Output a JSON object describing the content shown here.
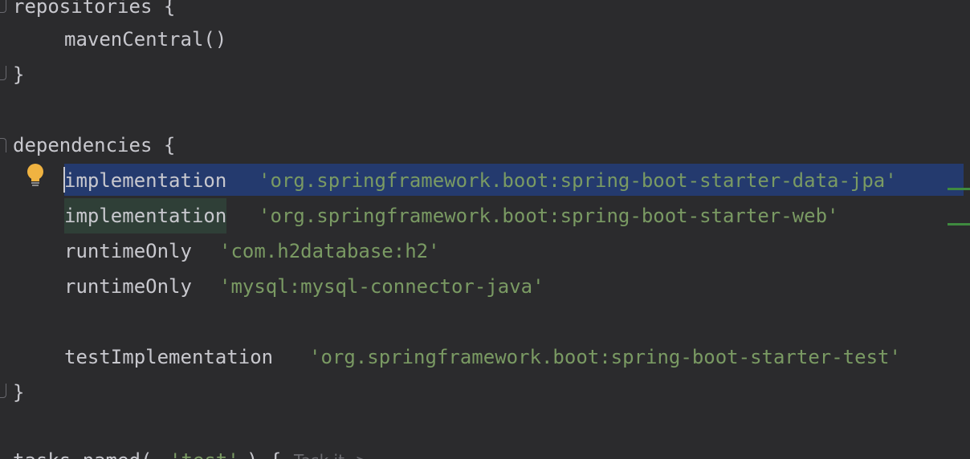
{
  "code": {
    "repositories_open": "repositories {",
    "maven_central": "mavenCentral()",
    "close_brace_1": "}",
    "dependencies_open": "dependencies {",
    "dep1_keyword": "implementation",
    "dep1_value": "'org.springframework.boot:spring-boot-starter-data-jpa'",
    "dep2_keyword": "implementation",
    "dep2_value": "'org.springframework.boot:spring-boot-starter-web'",
    "dep3_keyword": "runtimeOnly",
    "dep3_value": "'com.h2database:h2'",
    "dep4_keyword": "runtimeOnly",
    "dep4_value": "'mysql:mysql-connector-java'",
    "dep5_keyword": "testImplementation",
    "dep5_value": "'org.springframework.boot:spring-boot-starter-test'",
    "close_brace_2": "}",
    "tasks_prefix": "tasks.named(",
    "tasks_arg": "'test'",
    "tasks_suffix": ") {",
    "tasks_hint": "Task it ->"
  },
  "icons": {
    "intention": "lightbulb-icon",
    "fold": "fold-marker-icon"
  },
  "colors": {
    "background": "#2b2b2d",
    "text": "#c8c8ce",
    "string": "#7a9a63",
    "selection": "#243a6e",
    "usage_highlight": "#2f3f37",
    "bulb": "#f0b341",
    "vcs_added": "#3f8a3f"
  }
}
